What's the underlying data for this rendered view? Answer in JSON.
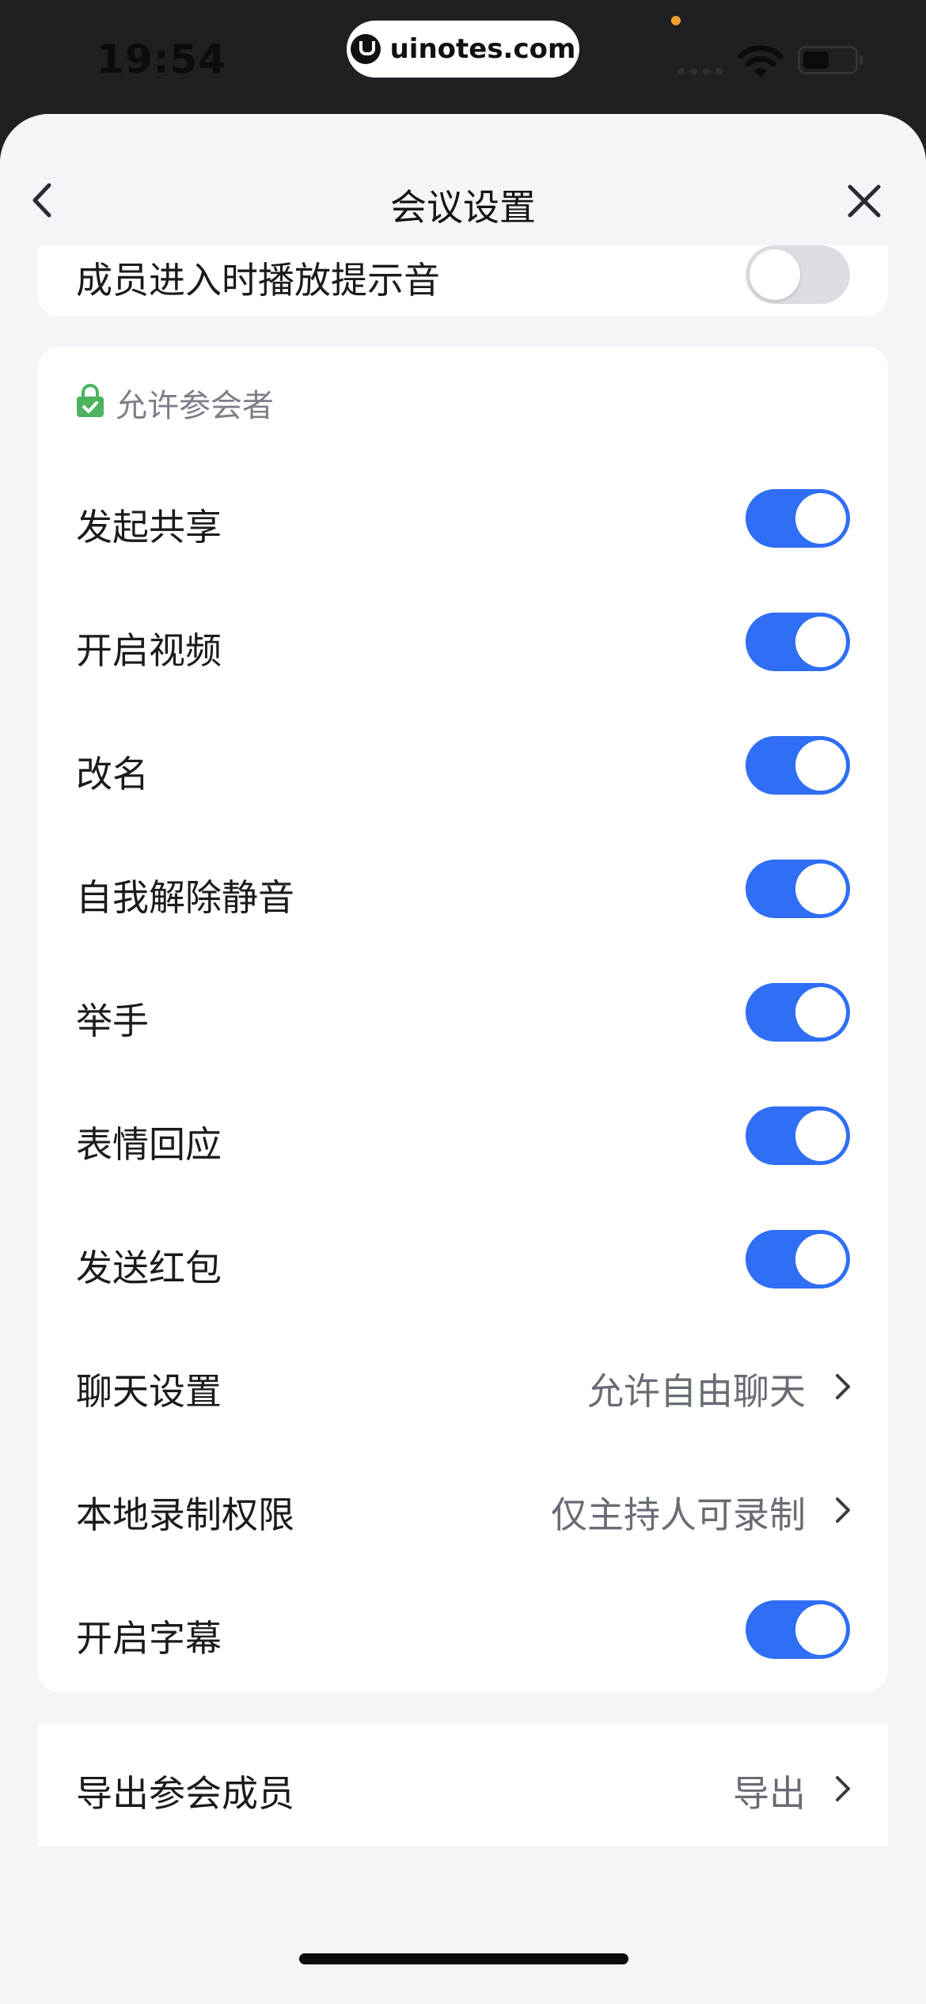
{
  "status_bar": {
    "time": "19:54",
    "watermark": "uinotes.com"
  },
  "nav": {
    "title": "会议设置"
  },
  "top_card": {
    "label": "成员进入时播放提示音",
    "enabled": false
  },
  "section": {
    "title": "允许参会者"
  },
  "rows": [
    {
      "label": "发起共享",
      "type": "toggle",
      "enabled": true
    },
    {
      "label": "开启视频",
      "type": "toggle",
      "enabled": true
    },
    {
      "label": "改名",
      "type": "toggle",
      "enabled": true
    },
    {
      "label": "自我解除静音",
      "type": "toggle",
      "enabled": true
    },
    {
      "label": "举手",
      "type": "toggle",
      "enabled": true
    },
    {
      "label": "表情回应",
      "type": "toggle",
      "enabled": true
    },
    {
      "label": "发送红包",
      "type": "toggle",
      "enabled": true
    },
    {
      "label": "聊天设置",
      "type": "link",
      "value": "允许自由聊天"
    },
    {
      "label": "本地录制权限",
      "type": "link",
      "value": "仅主持人可录制"
    },
    {
      "label": "开启字幕",
      "type": "toggle",
      "enabled": true
    }
  ],
  "export": {
    "label": "导出参会成员",
    "value": "导出"
  },
  "colors": {
    "accent": "#2f6ef5",
    "toggle_off": "#dcdde2",
    "background": "#f4f5f9",
    "lock_green": "#4cb35e"
  }
}
